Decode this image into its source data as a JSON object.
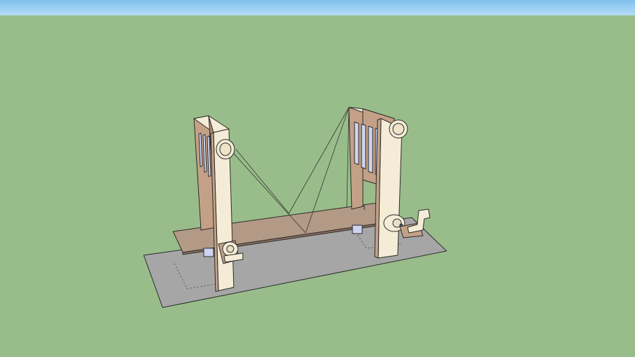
{
  "scene": {
    "sky_color": "#9fd2f2",
    "ground_color": "#99bd8a",
    "shadow_color": "#a6a6a6",
    "wood_color": "#c4a186",
    "wood_light": "#f4ecd6",
    "wood_dark": "#8a7060",
    "slot_color": "#cdd4f0",
    "edge_color": "#2a2a2a"
  }
}
